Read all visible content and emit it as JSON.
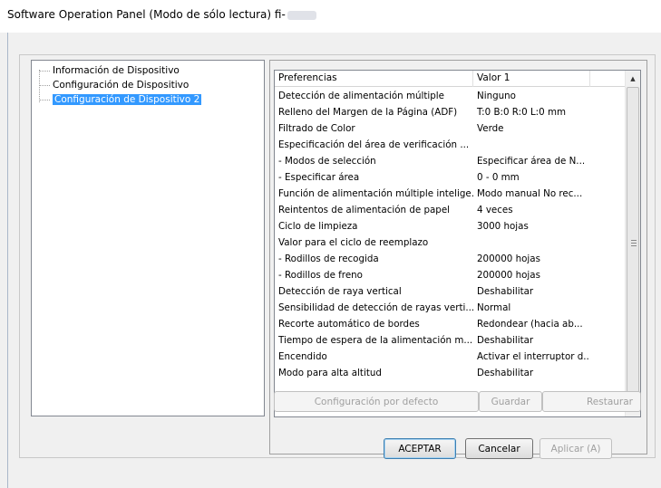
{
  "window": {
    "title": "Software Operation Panel (Modo de sólo lectura) fi-"
  },
  "tree": {
    "items": [
      {
        "label": "Información de Dispositivo",
        "selected": false
      },
      {
        "label": "Configuración de Dispositivo",
        "selected": false
      },
      {
        "label": "Configuración de Dispositivo 2",
        "selected": true
      }
    ]
  },
  "list": {
    "headers": [
      "Preferencias",
      "Valor 1",
      ""
    ],
    "rows": [
      [
        "Detección de alimentación múltiple",
        "Ninguno"
      ],
      [
        "Relleno del Margen de la Página (ADF)",
        "T:0  B:0  R:0  L:0 mm"
      ],
      [
        "Filtrado de Color",
        "Verde"
      ],
      [
        "Especificación del área de verificación ...",
        ""
      ],
      [
        " - Modos de selección",
        "Especificar área de N..."
      ],
      [
        " - Especificar área",
        "0 - 0 mm"
      ],
      [
        "Función de alimentación múltiple intelige...",
        "Modo manual  No rec..."
      ],
      [
        "Reintentos de alimentación de papel",
        "4 veces"
      ],
      [
        "Ciclo de limpieza",
        "3000 hojas"
      ],
      [
        "Valor para el ciclo de reemplazo",
        ""
      ],
      [
        " - Rodillos de recogida",
        "200000 hojas"
      ],
      [
        " - Rodillos de freno",
        "200000 hojas"
      ],
      [
        "Detección de raya vertical",
        "Deshabilitar"
      ],
      [
        "Sensibilidad de detección de rayas verti...",
        "Normal"
      ],
      [
        "Recorte automático de bordes",
        "Redondear (hacia ab..."
      ],
      [
        "Tiempo de espera de la alimentación m...",
        "Deshabilitar"
      ],
      [
        "Encendido",
        "Activar el interruptor d..."
      ],
      [
        "Modo para alta altitud",
        "Deshabilitar"
      ]
    ]
  },
  "panel_buttons": {
    "defaults_label": "Configuración por defecto",
    "save_label": "Guardar",
    "restore_label": "Restaurar"
  },
  "dialog_buttons": {
    "ok_label": "ACEPTAR",
    "cancel_label": "Cancelar",
    "apply_label": "Aplicar (A)"
  },
  "icons": {
    "scroll_up": "scroll-up-arrow-icon",
    "scroll_down": "scroll-down-arrow-icon"
  },
  "colors": {
    "selection": "#3399ff",
    "disabled_text": "#a0a0a0"
  }
}
